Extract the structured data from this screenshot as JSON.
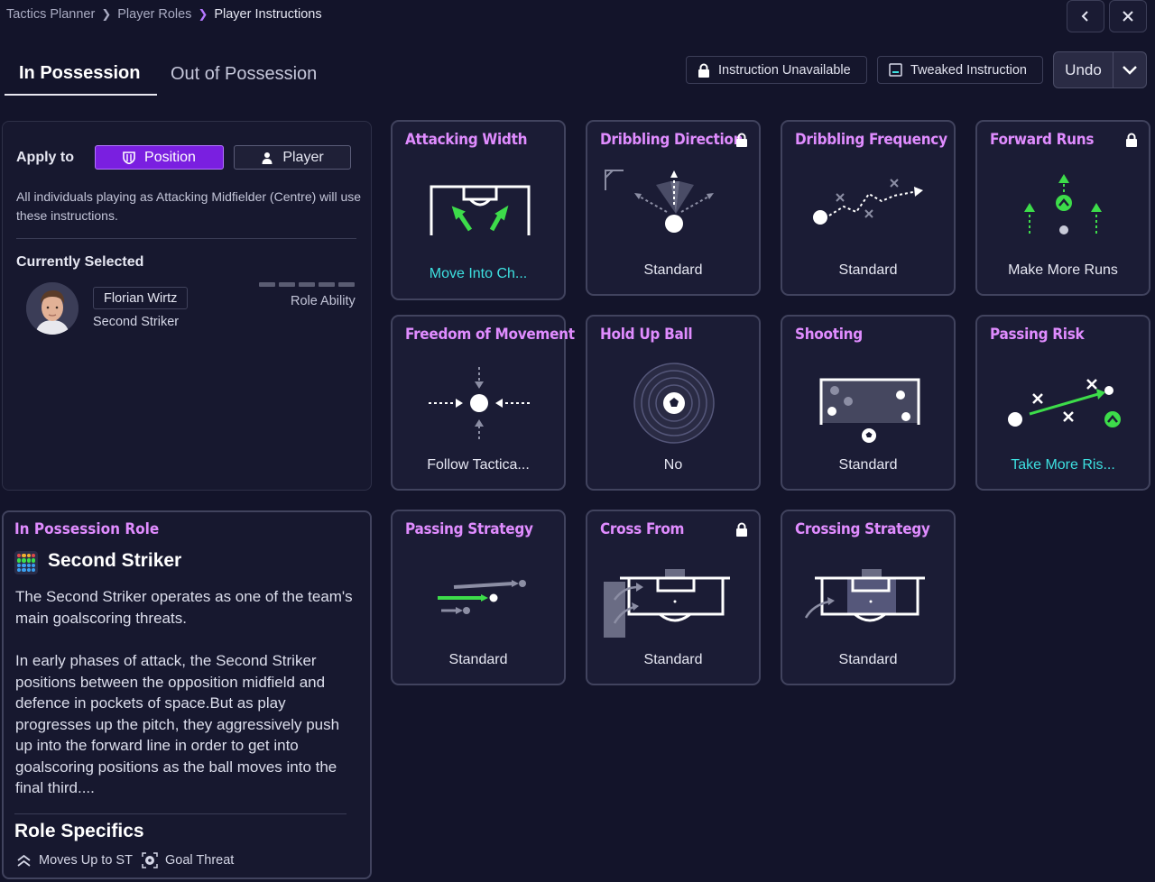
{
  "breadcrumb": [
    "Tactics Planner",
    "Player Roles",
    "Player Instructions"
  ],
  "tabs": [
    {
      "label": "In Possession",
      "active": true
    },
    {
      "label": "Out of Possession",
      "active": false
    }
  ],
  "legend": {
    "unavailable": "Instruction Unavailable",
    "tweaked": "Tweaked Instruction"
  },
  "undo_label": "Undo",
  "apply": {
    "label": "Apply to",
    "position_label": "Position",
    "player_label": "Player",
    "description": "All individuals playing as Attacking Midfielder (Centre) will use these instructions."
  },
  "selected": {
    "heading": "Currently Selected",
    "player_name": "Florian Wirtz",
    "role": "Second Striker",
    "ability_label": "Role Ability"
  },
  "role_panel": {
    "heading": "In Possession Role",
    "role_name": "Second Striker",
    "para1": "The Second Striker operates as one of the team's main goalscoring threats.",
    "para2": "In early phases of attack, the Second Striker positions between the opposition midfield and defence in pockets of space.But as play progresses up the pitch, they aggressively push up into the forward line in order to get into goalscoring positions as the ball moves into the final third....",
    "specifics_heading": "Role Specifics",
    "specifics": [
      {
        "label": "Moves Up to ST",
        "icon": "double-chevron-up-icon"
      },
      {
        "label": "Goal Threat",
        "icon": "ball-target-icon"
      }
    ]
  },
  "instructions": [
    {
      "title": "Attacking Width",
      "value": "Move Into Ch...",
      "tweaked": true,
      "locked": false
    },
    {
      "title": "Dribbling Direction",
      "value": "Standard",
      "tweaked": false,
      "locked": true
    },
    {
      "title": "Dribbling Frequency",
      "value": "Standard",
      "tweaked": false,
      "locked": false
    },
    {
      "title": "Forward Runs",
      "value": "Make More Runs",
      "tweaked": false,
      "locked": true
    },
    {
      "title": "Freedom of Movement",
      "value": "Follow Tactica...",
      "tweaked": false,
      "locked": false
    },
    {
      "title": "Hold Up Ball",
      "value": "No",
      "tweaked": false,
      "locked": false
    },
    {
      "title": "Shooting",
      "value": "Standard",
      "tweaked": false,
      "locked": false
    },
    {
      "title": "Passing Risk",
      "value": "Take More Ris...",
      "tweaked": true,
      "locked": false
    },
    {
      "title": "Passing Strategy",
      "value": "Standard",
      "tweaked": false,
      "locked": false
    },
    {
      "title": "Cross From",
      "value": "Standard",
      "tweaked": false,
      "locked": true
    },
    {
      "title": "Crossing Strategy",
      "value": "Standard",
      "tweaked": false,
      "locked": false
    }
  ],
  "colors": {
    "background": "#13142a",
    "accent_purple": "#7a1fe0",
    "title_pink": "#e08cff",
    "tweaked_cyan": "#3de0e0",
    "green": "#3ddc4a"
  }
}
